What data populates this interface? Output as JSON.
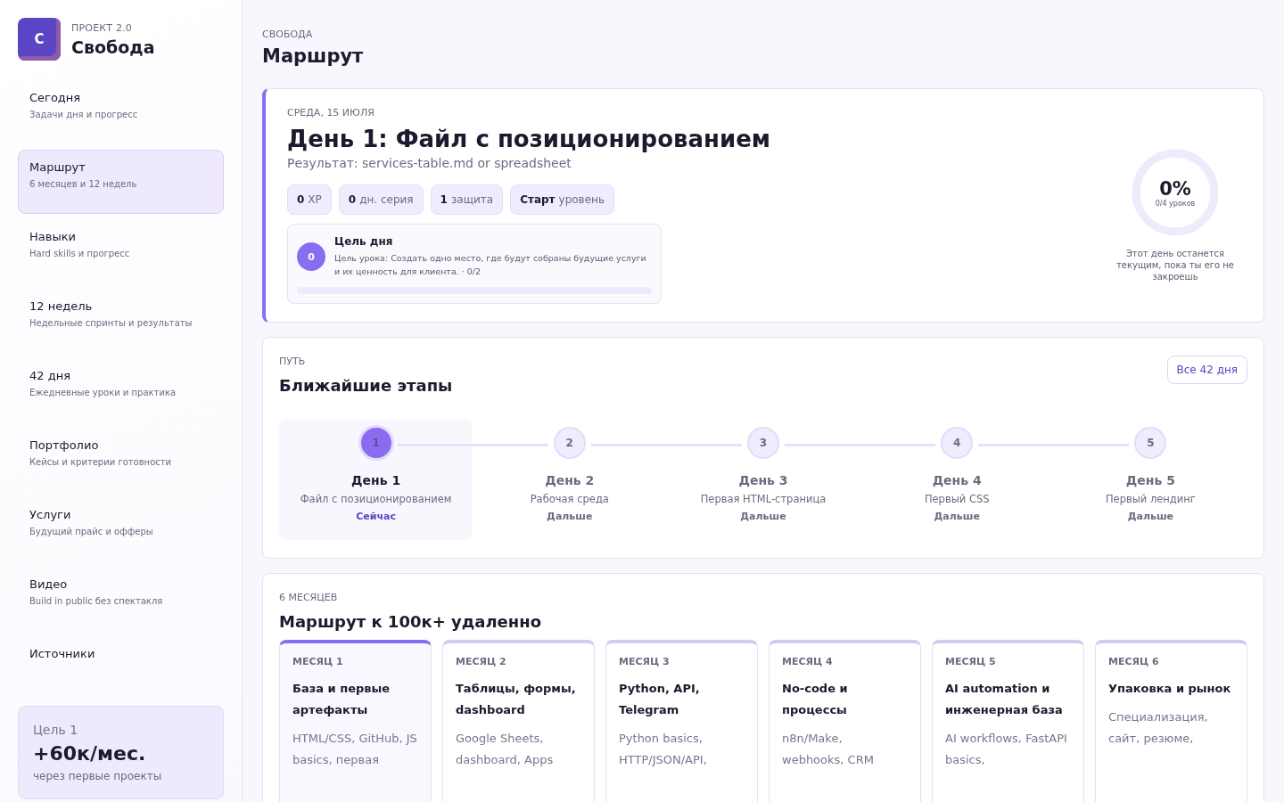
{
  "brand": {
    "logo_letter": "C",
    "overline": "ПРОЕКТ 2.0",
    "title": "Свобода"
  },
  "nav": [
    {
      "label": "Сегодня",
      "sub": "Задачи дня и прогресс",
      "selected": false
    },
    {
      "label": "Маршрут",
      "sub": "6 месяцев и 12 недель",
      "selected": true
    },
    {
      "label": "Навыки",
      "sub": "Hard skills и прогресс",
      "selected": false
    },
    {
      "label": "12 недель",
      "sub": "Недельные спринты и результаты",
      "selected": false
    },
    {
      "label": "42 дня",
      "sub": "Ежедневные уроки и практика",
      "selected": false
    },
    {
      "label": "Портфолио",
      "sub": "Кейсы и критерии готовности",
      "selected": false
    },
    {
      "label": "Услуги",
      "sub": "Будущий прайс и офферы",
      "selected": false
    },
    {
      "label": "Видео",
      "sub": "Build in public без спектакля",
      "selected": false
    },
    {
      "label": "Источники",
      "selected": false
    }
  ],
  "goal_card": {
    "label": "Цель 1",
    "value": "+60к/мес.",
    "note": "через первые проекты"
  },
  "header": {
    "overline": "СВОБОДА",
    "title": "Маршрут"
  },
  "today": {
    "date": "СРЕДА, 15 ИЮЛЯ",
    "title": "День 1: Файл с позиционированием",
    "result": "Результат: services-table.md or spreadsheet",
    "stats": [
      {
        "value": "0",
        "label": "XP"
      },
      {
        "value": "0",
        "label": "дн. серия"
      },
      {
        "value": "1",
        "label": "защита"
      },
      {
        "value": "Старт",
        "label": "уровень"
      }
    ],
    "goal": {
      "badge": "0",
      "title": "Цель дня",
      "text": "Цель урока: Создать одно место, где будут собраны будущие услуги и их ценность для клиента. · 0/2"
    },
    "progress": {
      "percent": "0%",
      "caption": "0/4 уроков",
      "note": "Этот день останется текущим, пока ты его не закроешь"
    }
  },
  "path": {
    "overline": "ПУТЬ",
    "title": "Ближайшие этапы",
    "button": "Все 42 дня",
    "steps": [
      {
        "number": "1",
        "title": "День 1",
        "sub": "Файл с позиционированием",
        "status": "Сейчас",
        "selected": true
      },
      {
        "number": "2",
        "title": "День 2",
        "sub": "Рабочая среда",
        "status": "Дальше",
        "selected": false
      },
      {
        "number": "3",
        "title": "День 3",
        "sub": "Первая HTML-страница",
        "status": "Дальше",
        "selected": false
      },
      {
        "number": "4",
        "title": "День 4",
        "sub": "Первый CSS",
        "status": "Дальше",
        "selected": false
      },
      {
        "number": "5",
        "title": "День 5",
        "sub": "Первый лендинг",
        "status": "Дальше",
        "selected": false
      }
    ]
  },
  "months": {
    "overline": "6 МЕСЯЦЕВ",
    "title": "Маршрут к 100к+ удаленно",
    "items": [
      {
        "label": "МЕСЯЦ 1",
        "title": "База и первые артефакты",
        "text": "HTML/CSS, GitHub, JS basics, первая",
        "selected": true
      },
      {
        "label": "МЕСЯЦ 2",
        "title": "Таблицы, формы, dashboard",
        "text": "Google Sheets, dashboard, Apps",
        "selected": false
      },
      {
        "label": "МЕСЯЦ 3",
        "title": "Python, API, Telegram",
        "text": "Python basics, HTTP/JSON/API,",
        "selected": false
      },
      {
        "label": "МЕСЯЦ 4",
        "title": "No-code и процессы",
        "text": "n8n/Make, webhooks, CRM",
        "selected": false
      },
      {
        "label": "МЕСЯЦ 5",
        "title": "AI automation и инженерная база",
        "text": "AI workflows, FastAPI basics,",
        "selected": false
      },
      {
        "label": "МЕСЯЦ 6",
        "title": "Упаковка и рынок",
        "text": "Специализация, сайт, резюме,",
        "selected": false
      }
    ]
  }
}
